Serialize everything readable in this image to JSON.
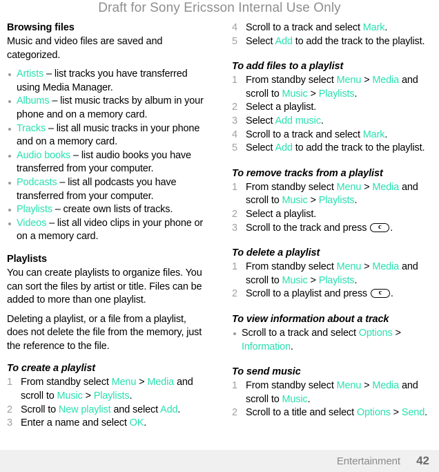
{
  "watermark": "Draft for Sony Ericsson Internal Use Only",
  "colors": {
    "link": "#2ae0b0",
    "watermark": "#8e8e8e",
    "step_number": "#a0a0a0",
    "footer_band": "#f0f0f0"
  },
  "footer": {
    "chapter": "Entertainment",
    "page": "42"
  },
  "left_column": {
    "browsing": {
      "heading": "Browsing files",
      "intro": "Music and video files are saved and categorized.",
      "bullets": [
        {
          "ref": "Artists",
          "text": " – list tracks you have transferred using Media Manager."
        },
        {
          "ref": "Albums",
          "text": " – list music tracks by album in your phone and on a memory card."
        },
        {
          "ref": "Tracks",
          "text": " – list all music tracks in your phone and on a memory card."
        },
        {
          "ref": "Audio books",
          "text": " – list audio books you have transferred from your computer."
        },
        {
          "ref": "Podcasts",
          "text": " – list all podcasts you have transferred from your computer."
        },
        {
          "ref": "Playlists",
          "text": " – create own lists of tracks."
        },
        {
          "ref": "Videos",
          "text": " – list all video clips in your phone or on a memory card."
        }
      ]
    },
    "playlists": {
      "heading": "Playlists",
      "para1": "You can create playlists to organize files. You can sort the files by artist or title. Files can be added to more than one playlist.",
      "para2": "Deleting a playlist, or a file from a playlist, does not delete the file from the memory, just the reference to the file."
    },
    "create_playlist": {
      "heading": "To create a playlist",
      "steps": [
        {
          "num": "1",
          "parts": [
            {
              "t": "text",
              "v": "From standby select "
            },
            {
              "t": "ref",
              "v": "Menu"
            },
            {
              "t": "text",
              "v": " > "
            },
            {
              "t": "ref",
              "v": "Media"
            },
            {
              "t": "text",
              "v": " and scroll to "
            },
            {
              "t": "ref",
              "v": "Music"
            },
            {
              "t": "text",
              "v": " > "
            },
            {
              "t": "ref",
              "v": "Playlists"
            },
            {
              "t": "text",
              "v": "."
            }
          ]
        },
        {
          "num": "2",
          "parts": [
            {
              "t": "text",
              "v": "Scroll to "
            },
            {
              "t": "ref",
              "v": "New playlist"
            },
            {
              "t": "text",
              "v": " and select "
            },
            {
              "t": "ref",
              "v": "Add"
            },
            {
              "t": "text",
              "v": "."
            }
          ]
        },
        {
          "num": "3",
          "parts": [
            {
              "t": "text",
              "v": "Enter a name and select "
            },
            {
              "t": "ref",
              "v": "OK"
            },
            {
              "t": "text",
              "v": "."
            }
          ]
        }
      ]
    }
  },
  "right_column": {
    "create_playlist_cont": {
      "steps": [
        {
          "num": "4",
          "parts": [
            {
              "t": "text",
              "v": "Scroll to a track and select "
            },
            {
              "t": "ref",
              "v": "Mark"
            },
            {
              "t": "text",
              "v": "."
            }
          ]
        },
        {
          "num": "5",
          "parts": [
            {
              "t": "text",
              "v": "Select "
            },
            {
              "t": "ref",
              "v": "Add"
            },
            {
              "t": "text",
              "v": " to add the track to the playlist."
            }
          ]
        }
      ]
    },
    "add_files": {
      "heading": "To add files to a playlist",
      "steps": [
        {
          "num": "1",
          "parts": [
            {
              "t": "text",
              "v": "From standby select "
            },
            {
              "t": "ref",
              "v": "Menu"
            },
            {
              "t": "text",
              "v": " > "
            },
            {
              "t": "ref",
              "v": "Media"
            },
            {
              "t": "text",
              "v": " and scroll to "
            },
            {
              "t": "ref",
              "v": "Music"
            },
            {
              "t": "text",
              "v": " > "
            },
            {
              "t": "ref",
              "v": "Playlists"
            },
            {
              "t": "text",
              "v": "."
            }
          ]
        },
        {
          "num": "2",
          "parts": [
            {
              "t": "text",
              "v": "Select a playlist."
            }
          ]
        },
        {
          "num": "3",
          "parts": [
            {
              "t": "text",
              "v": "Select "
            },
            {
              "t": "ref",
              "v": "Add music"
            },
            {
              "t": "text",
              "v": "."
            }
          ]
        },
        {
          "num": "4",
          "parts": [
            {
              "t": "text",
              "v": "Scroll to a track and select "
            },
            {
              "t": "ref",
              "v": "Mark"
            },
            {
              "t": "text",
              "v": "."
            }
          ]
        },
        {
          "num": "5",
          "parts": [
            {
              "t": "text",
              "v": "Select "
            },
            {
              "t": "ref",
              "v": "Add"
            },
            {
              "t": "text",
              "v": " to add the track to the playlist."
            }
          ]
        }
      ]
    },
    "remove_tracks": {
      "heading": "To remove tracks from a playlist",
      "steps": [
        {
          "num": "1",
          "parts": [
            {
              "t": "text",
              "v": "From standby select "
            },
            {
              "t": "ref",
              "v": "Menu"
            },
            {
              "t": "text",
              "v": " > "
            },
            {
              "t": "ref",
              "v": "Media"
            },
            {
              "t": "text",
              "v": " and scroll to "
            },
            {
              "t": "ref",
              "v": "Music"
            },
            {
              "t": "text",
              "v": " > "
            },
            {
              "t": "ref",
              "v": "Playlists"
            },
            {
              "t": "text",
              "v": "."
            }
          ]
        },
        {
          "num": "2",
          "parts": [
            {
              "t": "text",
              "v": "Select a playlist."
            }
          ]
        },
        {
          "num": "3",
          "parts": [
            {
              "t": "text",
              "v": "Scroll to the track and press "
            },
            {
              "t": "keycap",
              "v": "c"
            },
            {
              "t": "text",
              "v": "."
            }
          ]
        }
      ]
    },
    "delete_playlist": {
      "heading": "To delete a playlist",
      "steps": [
        {
          "num": "1",
          "parts": [
            {
              "t": "text",
              "v": "From standby select "
            },
            {
              "t": "ref",
              "v": "Menu"
            },
            {
              "t": "text",
              "v": " > "
            },
            {
              "t": "ref",
              "v": "Media"
            },
            {
              "t": "text",
              "v": " and scroll to "
            },
            {
              "t": "ref",
              "v": "Music"
            },
            {
              "t": "text",
              "v": " > "
            },
            {
              "t": "ref",
              "v": "Playlists"
            },
            {
              "t": "text",
              "v": "."
            }
          ]
        },
        {
          "num": "2",
          "parts": [
            {
              "t": "text",
              "v": "Scroll to a playlist and press "
            },
            {
              "t": "keycap",
              "v": "c"
            },
            {
              "t": "text",
              "v": "."
            }
          ]
        }
      ]
    },
    "view_info": {
      "heading": "To view information about a track",
      "bullets": [
        {
          "parts": [
            {
              "t": "text",
              "v": "Scroll to a track and select "
            },
            {
              "t": "ref",
              "v": "Options"
            },
            {
              "t": "text",
              "v": " > "
            },
            {
              "t": "ref",
              "v": "Information"
            },
            {
              "t": "text",
              "v": "."
            }
          ]
        }
      ]
    },
    "send_music": {
      "heading": "To send music",
      "steps": [
        {
          "num": "1",
          "parts": [
            {
              "t": "text",
              "v": "From standby select "
            },
            {
              "t": "ref",
              "v": "Menu"
            },
            {
              "t": "text",
              "v": " > "
            },
            {
              "t": "ref",
              "v": "Media"
            },
            {
              "t": "text",
              "v": " and scroll to "
            },
            {
              "t": "ref",
              "v": "Music"
            },
            {
              "t": "text",
              "v": "."
            }
          ]
        },
        {
          "num": "2",
          "parts": [
            {
              "t": "text",
              "v": "Scroll to a title and select "
            },
            {
              "t": "ref",
              "v": "Options"
            },
            {
              "t": "text",
              "v": " > "
            },
            {
              "t": "ref",
              "v": "Send"
            },
            {
              "t": "text",
              "v": "."
            }
          ]
        }
      ]
    }
  }
}
